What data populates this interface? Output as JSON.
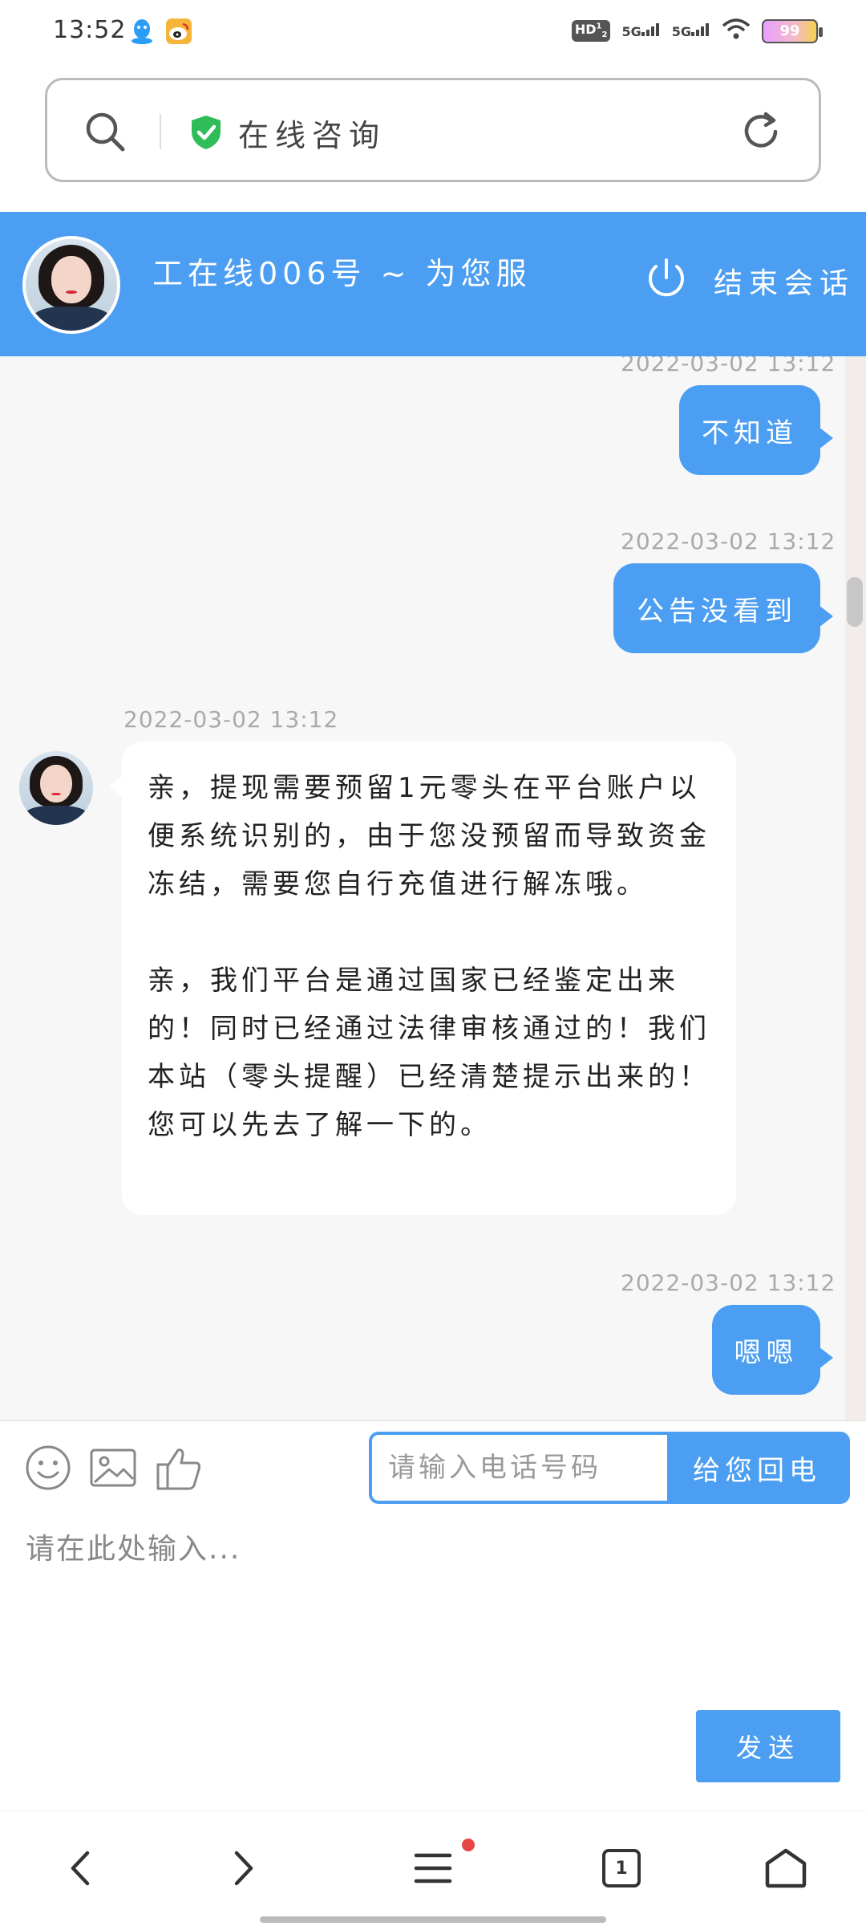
{
  "status_bar": {
    "time": "13:52",
    "hd_badge": "HD",
    "hd_sup": "1",
    "hd_sub": "2",
    "signal1": "5G",
    "signal2": "5G",
    "battery": "99"
  },
  "browser": {
    "url_title": "在线咨询"
  },
  "chat_header": {
    "agent_title": "工在线006号 ~ 为您服",
    "end_session": "结束会话"
  },
  "messages": [
    {
      "side": "out",
      "time": "2022-03-02 13:12",
      "text": "不知道"
    },
    {
      "side": "out",
      "time": "2022-03-02 13:12",
      "text": "公告没看到"
    },
    {
      "side": "in",
      "time": "2022-03-02 13:12",
      "p1": "亲，提现需要预留1元零头在平台账户以便系统识别的，由于您没预留而导致资金冻结，需要您自行充值进行解冻哦。",
      "p2": "亲，我们平台是通过国家已经鉴定出来的！同时已经通过法律审核通过的！我们本站（零头提醒）已经清楚提示出来的！您可以先去了解一下的。"
    },
    {
      "side": "out",
      "time": "2022-03-02 13:12",
      "text": "嗯嗯"
    }
  ],
  "input_area": {
    "phone_placeholder": "请输入电话号码",
    "callback_label": "给您回电",
    "message_placeholder": "请在此处输入...",
    "send_label": "发送"
  },
  "navbar": {
    "tab_count": "1"
  },
  "colors": {
    "accent": "#4b9ef1",
    "shield": "#2ebd59",
    "notification_dot": "#e84545"
  }
}
